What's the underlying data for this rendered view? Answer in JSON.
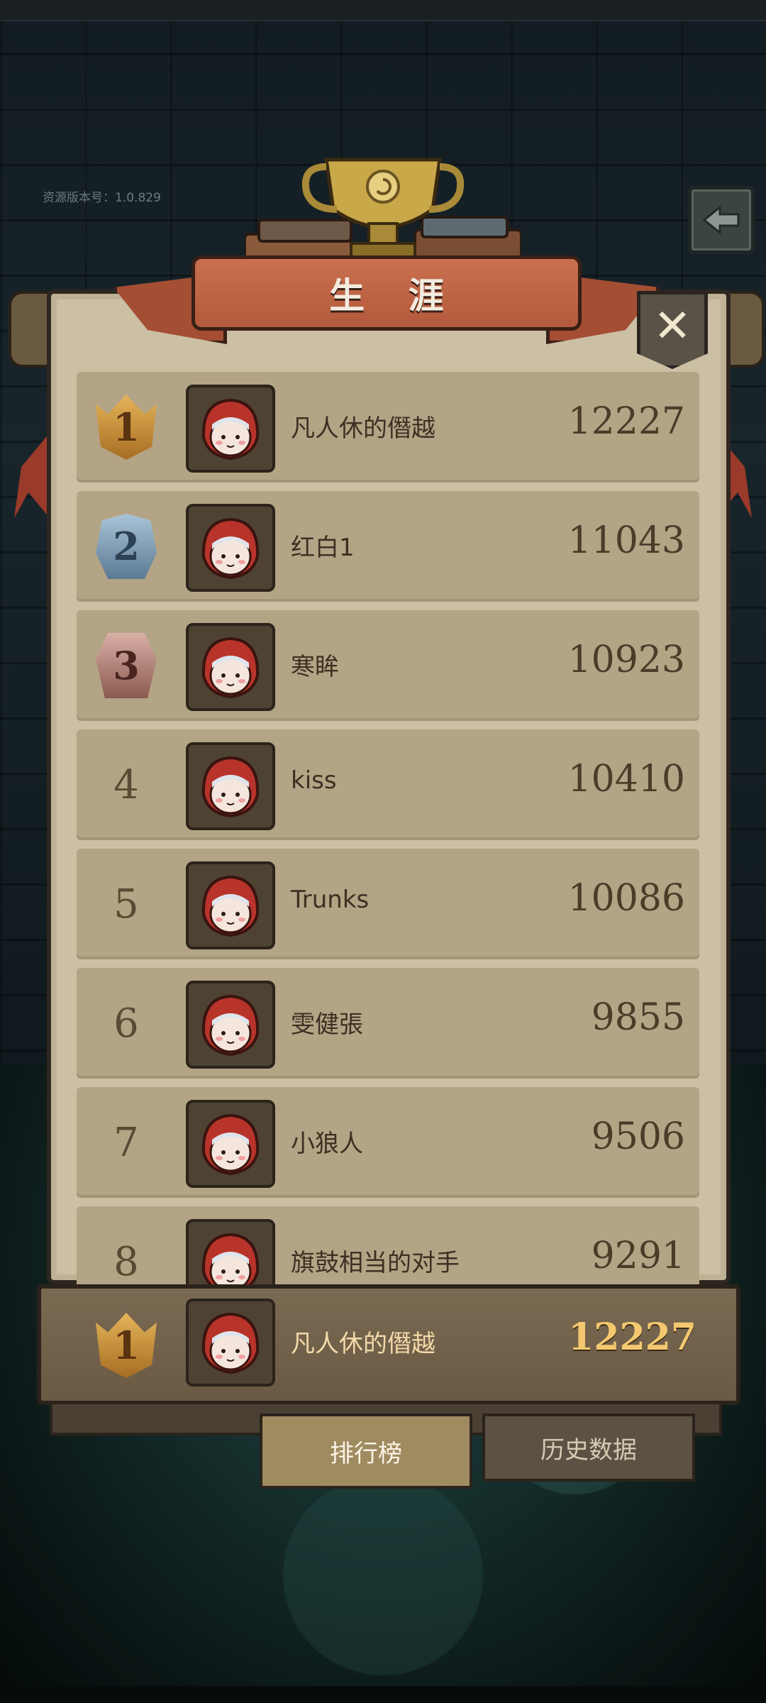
{
  "version_label": "资源版本号：1.0.829",
  "title": "生 涯",
  "close_label": "✕",
  "rows": [
    {
      "rank": "1",
      "medal": "gold",
      "name": "凡人休的僭越",
      "score": "12227"
    },
    {
      "rank": "2",
      "medal": "silver",
      "name": "红白1",
      "score": "11043"
    },
    {
      "rank": "3",
      "medal": "bronze",
      "name": "寒眸",
      "score": "10923"
    },
    {
      "rank": "4",
      "medal": "",
      "name": "kiss",
      "score": "10410"
    },
    {
      "rank": "5",
      "medal": "",
      "name": "Trunks",
      "score": "10086"
    },
    {
      "rank": "6",
      "medal": "",
      "name": "雯健張",
      "score": "9855"
    },
    {
      "rank": "7",
      "medal": "",
      "name": "小狼人",
      "score": "9506"
    },
    {
      "rank": "8",
      "medal": "",
      "name": "旗鼓相当的对手",
      "score": "9291"
    }
  ],
  "my_rank": {
    "rank": "1",
    "medal": "gold",
    "name": "凡人休的僭越",
    "score": "12227"
  },
  "tabs": {
    "leaderboard": "排行榜",
    "history": "历史数据"
  },
  "colors": {
    "panel": "#cbbfa4",
    "row": "#b3a485",
    "banner": "#b45a3c",
    "accent_gold": "#f4c870"
  }
}
